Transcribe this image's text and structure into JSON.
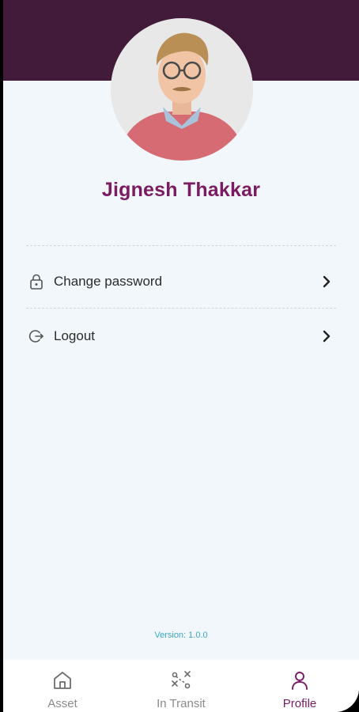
{
  "profile": {
    "name": "Jignesh Thakkar",
    "avatar_icon": "user-photo"
  },
  "menu": {
    "items": [
      {
        "label": "Change password",
        "icon": "lock-icon"
      },
      {
        "label": "Logout",
        "icon": "logout-icon"
      }
    ]
  },
  "footer": {
    "version": "Version: 1.0.0"
  },
  "bottom_nav": {
    "items": [
      {
        "label": "Asset",
        "icon": "home-icon",
        "active": false
      },
      {
        "label": "In Transit",
        "icon": "route-icon",
        "active": false
      },
      {
        "label": "Profile",
        "icon": "person-icon",
        "active": true
      }
    ]
  },
  "colors": {
    "header": "#421a3a",
    "accent": "#7a1b63",
    "background": "#f1f7fa",
    "version_text": "#3fa7c1"
  }
}
